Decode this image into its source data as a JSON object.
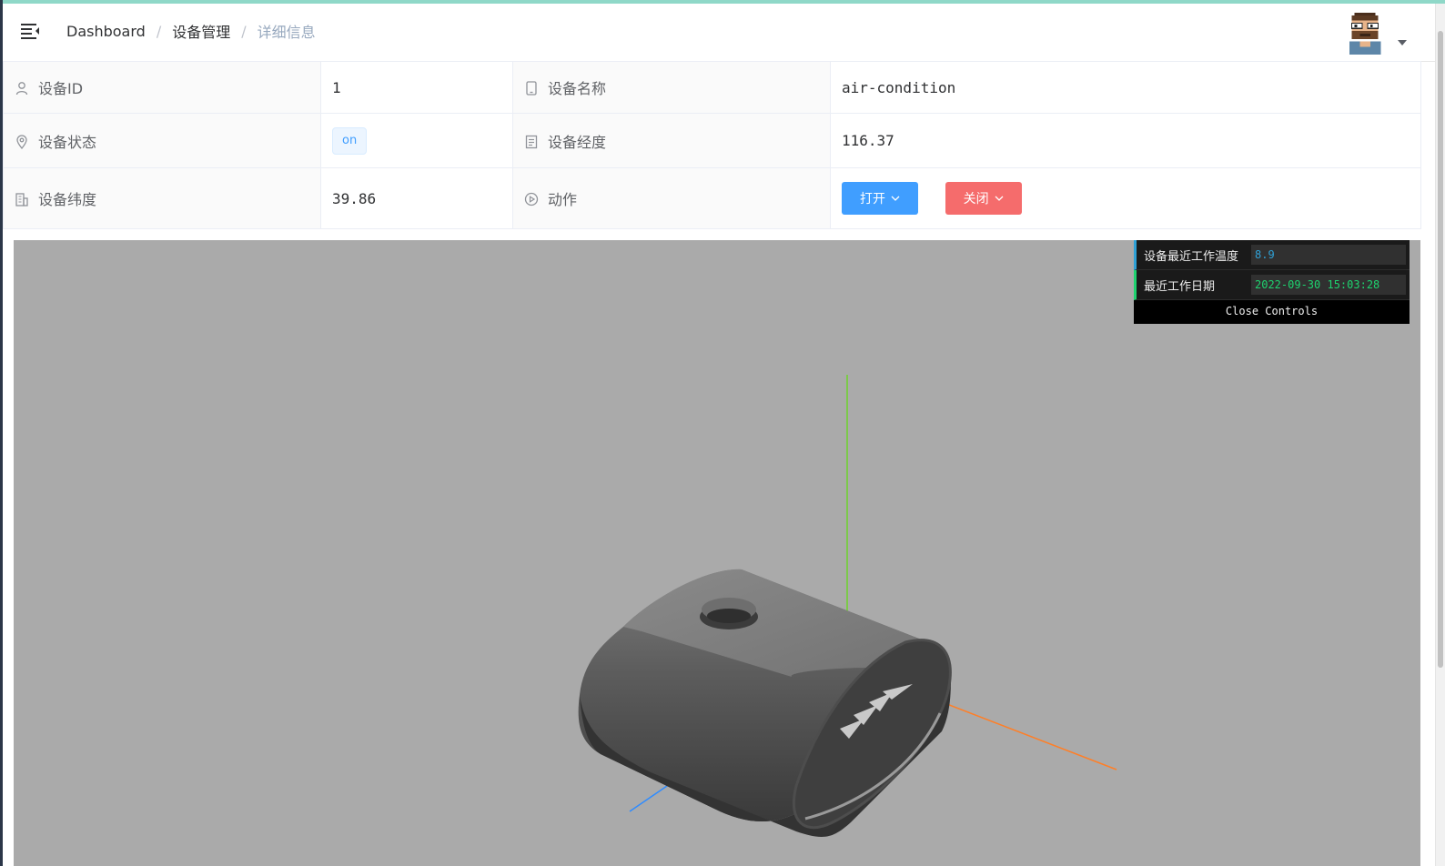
{
  "breadcrumb": {
    "items": [
      "Dashboard",
      "设备管理",
      "详细信息"
    ],
    "separator": "/"
  },
  "device": {
    "id_label": "设备ID",
    "id_value": "1",
    "name_label": "设备名称",
    "name_value": "air-condition",
    "status_label": "设备状态",
    "status_value": "on",
    "longitude_label": "设备经度",
    "longitude_value": "116.37",
    "latitude_label": "设备纬度",
    "latitude_value": "39.86",
    "action_label": "动作",
    "open_button": "打开",
    "close_button": "关闭"
  },
  "controls": {
    "temperature_label": "设备最近工作温度",
    "temperature_value": "8.9",
    "date_label": "最近工作日期",
    "date_value": "2022-09-30 15:03:28",
    "close_controls": "Close Controls"
  },
  "icons": {
    "menu": "hamburger-icon",
    "id": "user-icon",
    "name": "tablet-icon",
    "status": "location-icon",
    "longitude": "document-icon",
    "latitude": "office-building-icon",
    "action": "video-play-icon",
    "dropdown": "chevron-down-icon"
  },
  "colors": {
    "primary": "#409eff",
    "danger": "#f56c6c",
    "viewport_bg": "#aaaaaa",
    "axis_x": "#ff7f27",
    "axis_y": "#6cd32a",
    "axis_z": "#2f8cff"
  }
}
